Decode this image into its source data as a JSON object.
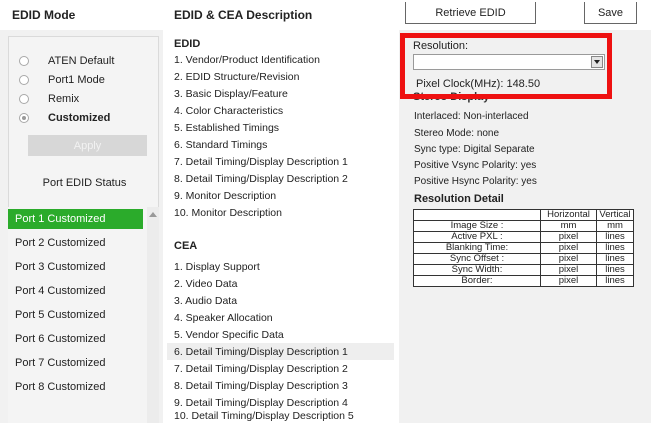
{
  "header": {
    "edid_mode": "EDID Mode",
    "edid_cea_description": "EDID & CEA Description",
    "retrieve_btn": "Retrieve EDID",
    "save_btn": "Save"
  },
  "mode": {
    "options": [
      {
        "label": "ATEN Default",
        "checked": false
      },
      {
        "label": "Port1 Mode",
        "checked": false
      },
      {
        "label": "Remix",
        "checked": false
      },
      {
        "label": "Customized",
        "checked": true
      }
    ],
    "apply_btn": "Apply",
    "port_status_label": "Port EDID Status"
  },
  "ports": [
    {
      "label": "Port 1  Customized",
      "active": true
    },
    {
      "label": "Port 2  Customized",
      "active": false
    },
    {
      "label": "Port 3  Customized",
      "active": false
    },
    {
      "label": "Port 4  Customized",
      "active": false
    },
    {
      "label": "Port 5  Customized",
      "active": false
    },
    {
      "label": "Port 6  Customized",
      "active": false
    },
    {
      "label": "Port 7  Customized",
      "active": false
    },
    {
      "label": "Port 8  Customized",
      "active": false
    }
  ],
  "edid": {
    "title": "EDID",
    "items": [
      "1.  Vendor/Product Identification",
      "2.  EDID Structure/Revision",
      "3.  Basic Display/Feature",
      "4.  Color Characteristics",
      "5.  Established Timings",
      "6.  Standard Timings",
      "7.  Detail Timing/Display Description 1",
      "8.  Detail Timing/Display Description 2",
      "9.  Monitor Description",
      "10.  Monitor Description"
    ]
  },
  "cea": {
    "title": "CEA",
    "highlighted_index": 5,
    "items": [
      "1.  Display Support",
      "2.  Video Data",
      "3.  Audio Data",
      "4.  Speaker Allocation",
      "5.  Vendor Specific Data",
      "6.  Detail Timing/Display Description 1",
      "7.  Detail Timing/Display Description 2",
      "8.  Detail Timing/Display Description 3",
      "9.  Detail Timing/Display Description 4",
      "10.  Detail Timing/Display Description 5"
    ]
  },
  "detail": {
    "resolution_label": "Resolution:",
    "resolution_value": "",
    "pixel_clock": "Pixel Clock(MHz): 148.50",
    "stereo_title": "Stereo Display",
    "info_lines": [
      "Interlaced: Non-interlaced",
      "Stereo Mode: none",
      "Sync type: Digital Separate",
      "Positive Vsync Polarity: yes",
      "Positive Hsync Polarity: yes"
    ],
    "resolution_detail_title": "Resolution Detail",
    "table": {
      "headers": [
        "",
        "Horizontal",
        "Vertical"
      ],
      "rows": [
        [
          "Image Size :",
          "mm",
          "mm"
        ],
        [
          "Active PXL :",
          "pixel",
          "lines"
        ],
        [
          "Blanking Time:",
          "pixel",
          "lines"
        ],
        [
          "Sync Offset :",
          "pixel",
          "lines"
        ],
        [
          "Sync Width:",
          "pixel",
          "lines"
        ],
        [
          "Border:",
          "pixel",
          "lines"
        ]
      ]
    }
  },
  "colors": {
    "active_port": "#2bab2b",
    "highlight_box": "#ee1111",
    "panel_bg": "#f1f1f1"
  }
}
